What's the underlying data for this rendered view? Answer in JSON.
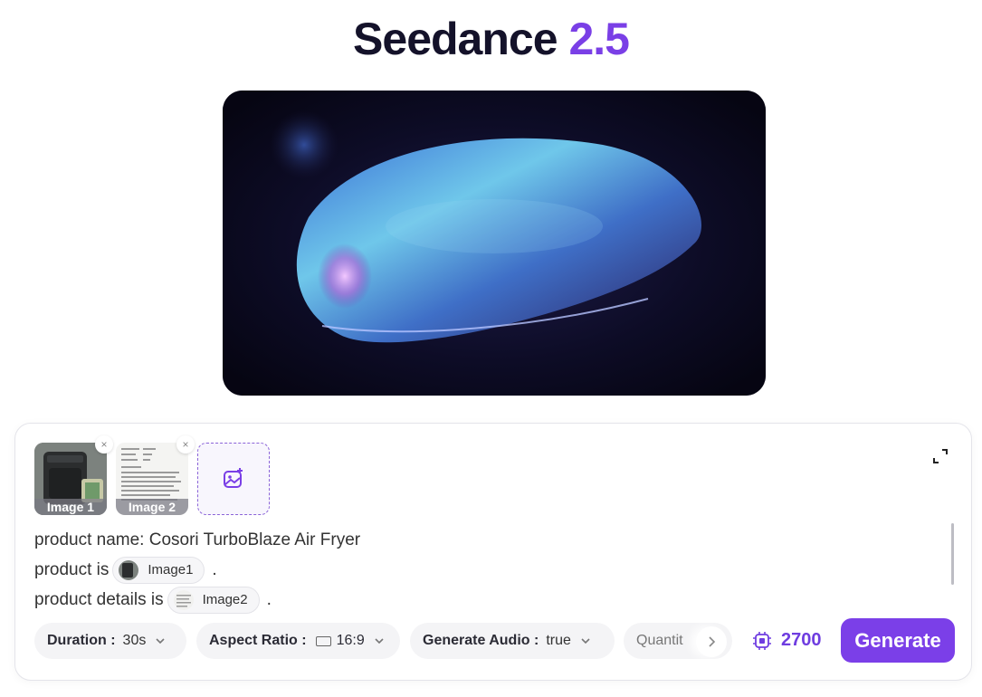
{
  "app": {
    "title_main": "Seedance",
    "title_version": "2.5"
  },
  "uploads": [
    {
      "label": "Image 1",
      "remove": "×"
    },
    {
      "label": "Image 2",
      "remove": "×"
    }
  ],
  "prompt": {
    "line1": "product name: Cosori TurboBlaze Air Fryer",
    "line2_prefix": "product is",
    "line2_chip": "Image1",
    "line3_prefix": "product details is",
    "line3_chip": "Image2",
    "line_end": "."
  },
  "controls": {
    "duration": {
      "label": "Duration :",
      "value": "30s"
    },
    "aspect_ratio": {
      "label": "Aspect Ratio :",
      "value": "16:9"
    },
    "generate_audio": {
      "label": "Generate Audio :",
      "value": "true"
    },
    "quantity": {
      "label": "Quantit"
    }
  },
  "credits": {
    "value": "2700"
  },
  "generate_button": {
    "label": "Generate"
  },
  "colors": {
    "accent": "#7b3fe8",
    "title_dark": "#14122a"
  },
  "icons": [
    "close-icon",
    "add-image-icon",
    "expand-icon",
    "chevron-down-icon",
    "chevron-right-icon",
    "credits-chip-icon"
  ]
}
